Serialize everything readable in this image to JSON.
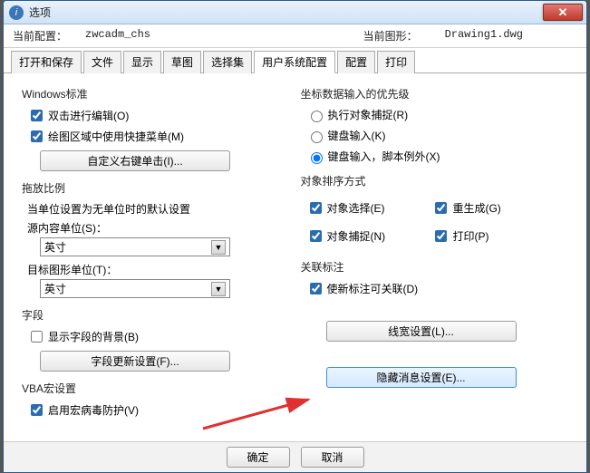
{
  "titlebar": {
    "icon_text": "i",
    "title": "选项",
    "close": "✕"
  },
  "info": {
    "label_current": "当前配置：",
    "value_current": "zwcadm_chs",
    "label_drawing": "当前图形：",
    "value_drawing": "Drawing1.dwg"
  },
  "tabs": [
    "打开和保存",
    "文件",
    "显示",
    "草图",
    "选择集",
    "用户系统配置",
    "配置",
    "打印"
  ],
  "active_tab_index": 5,
  "left": {
    "g1": {
      "title": "Windows标准",
      "chk1": "双击进行编辑(O)",
      "chk2": "绘图区域中使用快捷菜单(M)",
      "btn": "自定义右键单击(I)..."
    },
    "g2": {
      "title": "拖放比例",
      "desc": "当单位设置为无单位时的默认设置",
      "lbl1": "源内容单位(S)：",
      "sel1": "英寸",
      "lbl2": "目标图形单位(T)：",
      "sel2": "英寸"
    },
    "g3": {
      "title": "字段",
      "chk": "显示字段的背景(B)",
      "btn": "字段更新设置(F)..."
    },
    "g4": {
      "title": "VBA宏设置",
      "chk": "启用宏病毒防护(V)"
    }
  },
  "right": {
    "g1": {
      "title": "坐标数据输入的优先级",
      "r1": "执行对象捕捉(R)",
      "r2": "键盘输入(K)",
      "r3": "键盘输入，脚本例外(X)"
    },
    "g2": {
      "title": "对象排序方式",
      "c1": "对象选择(E)",
      "c2": "重生成(G)",
      "c3": "对象捕捉(N)",
      "c4": "打印(P)"
    },
    "g3": {
      "title": "关联标注",
      "c1": "使新标注可关联(D)"
    },
    "btn_lw": "线宽设置(L)...",
    "btn_hide": "隐藏消息设置(E)..."
  },
  "footer": {
    "ok": "确定",
    "cancel": "取消"
  }
}
